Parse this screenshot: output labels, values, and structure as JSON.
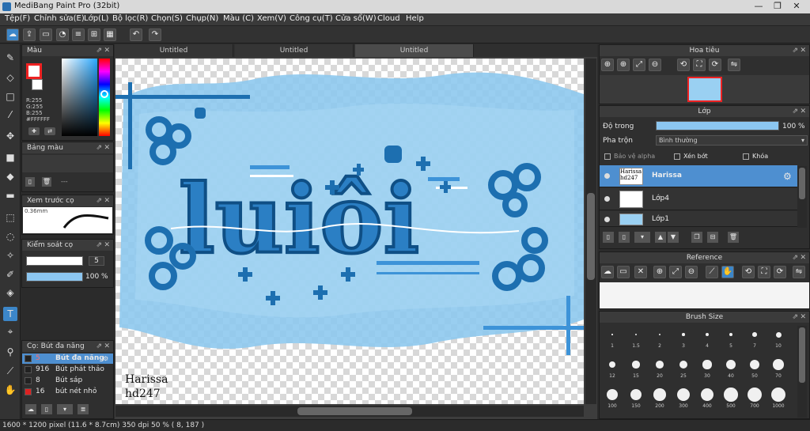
{
  "window": {
    "title": "MediBang Paint Pro (32bit)",
    "controls": [
      "—",
      "❐",
      "✕"
    ]
  },
  "menu": [
    "Tệp(F)",
    "Chỉnh sửa(E)",
    "Lớp(L)",
    "Bộ lọc(R)",
    "Chọn(S)",
    "Chụp(N)",
    "Màu (C)",
    "Xem(V)",
    "Công cụ(T)",
    "Cửa sổ(W)",
    "Cloud",
    "Help"
  ],
  "toolbar": {
    "undo_icon": "undo-icon",
    "redo_icon": "redo-icon"
  },
  "color_panel": {
    "title": "Màu",
    "r": "R:255",
    "g": "G:255",
    "b": "B:255",
    "hex": "#FFFFFF",
    "primary_color": "#ee2222",
    "secondary_color": "#ffffff"
  },
  "palette_panel": {
    "title": "Bảng màu",
    "dash": "---"
  },
  "preview_panel": {
    "title": "Xem trước cọ",
    "size": "0.36mm"
  },
  "brush_control": {
    "title": "Kiểm soát cọ",
    "size_value": "5",
    "opacity_value": "100 %",
    "opacity_fraction": 1.0
  },
  "brush_list": {
    "title": "Cọ: Bút đa năng",
    "items": [
      {
        "size": "5",
        "name": "Bút đa năng",
        "color": "#222222",
        "selected": true
      },
      {
        "size": "916",
        "name": "Bút phát thảo",
        "color": "#222222",
        "selected": false
      },
      {
        "size": "8",
        "name": "Bút sáp",
        "color": "#222222",
        "selected": false
      },
      {
        "size": "16",
        "name": "bút nét nhỏ",
        "color": "#dd2222",
        "selected": false
      }
    ]
  },
  "tabs": [
    "Untitled",
    "Untitled",
    "Untitled"
  ],
  "canvas": {
    "lettering": "luiôi",
    "signature_line1": "Harissa",
    "signature_line2": "hd247",
    "accent": "#1d6fb0",
    "wash": "#8ec9ee"
  },
  "navigator": {
    "title": "Hoa tiêu"
  },
  "layer_panel": {
    "title": "Lớp",
    "opacity_label": "Độ trong",
    "opacity_value": "100 %",
    "opacity_fraction": 1.0,
    "blend_label": "Pha trộn",
    "blend_value": "Bình thường",
    "protect_alpha": "Bảo vệ alpha",
    "clipping": "Xén bớt",
    "lock": "Khóa",
    "layers": [
      {
        "name": "Harissa",
        "thumb": "Harissa hd247",
        "selected": true
      },
      {
        "name": "Lớp4",
        "thumb": "",
        "selected": false
      },
      {
        "name": "Lớp1",
        "thumb": "",
        "selected": false
      }
    ]
  },
  "reference_panel": {
    "title": "Reference"
  },
  "brush_size_panel": {
    "title": "Brush Size",
    "sizes": [
      "1",
      "1.5",
      "2",
      "3",
      "4",
      "5",
      "7",
      "10",
      "12",
      "15",
      "20",
      "25",
      "30",
      "40",
      "50",
      "70",
      "100",
      "150",
      "200",
      "300",
      "400",
      "500",
      "700",
      "1000"
    ]
  },
  "status": {
    "text": "1600 * 1200 pixel   (11.6 * 8.7cm)   350 dpi   50 %   ( 8, 187 )"
  }
}
